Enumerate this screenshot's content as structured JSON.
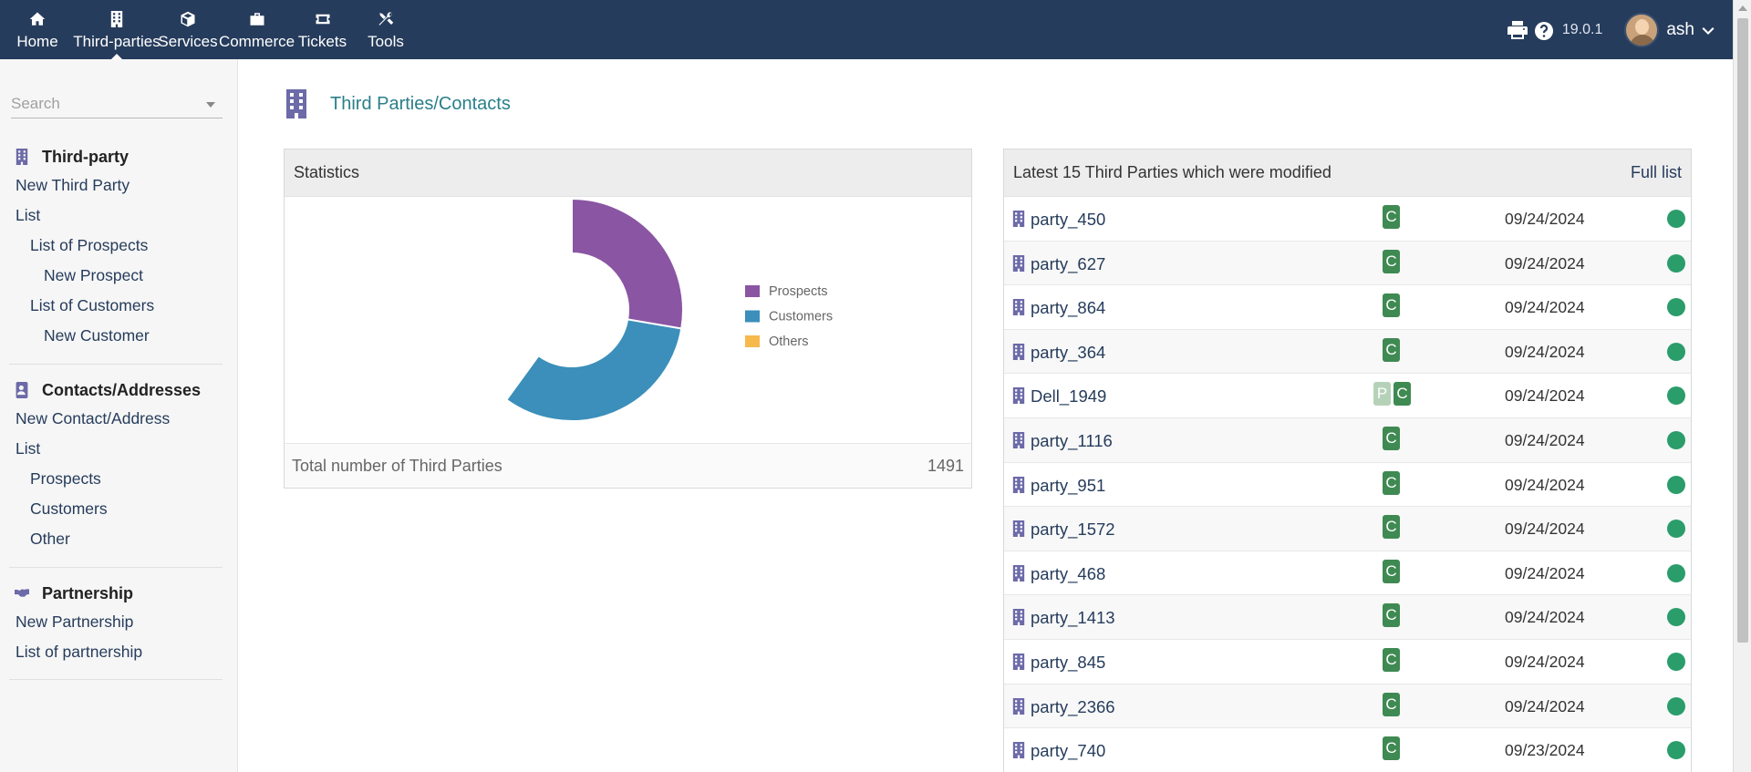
{
  "topnav": {
    "items": [
      {
        "label": "Home",
        "icon": "home-icon"
      },
      {
        "label": "Third-parties",
        "icon": "building-icon",
        "active": true
      },
      {
        "label": "Services",
        "icon": "cube-icon"
      },
      {
        "label": "Commerce",
        "icon": "briefcase-icon"
      },
      {
        "label": "Tickets",
        "icon": "ticket-icon"
      },
      {
        "label": "Tools",
        "icon": "tools-icon"
      }
    ],
    "version": "19.0.1",
    "username": "ash"
  },
  "sidebar": {
    "search_placeholder": "Search",
    "sections": [
      {
        "title": "Third-party",
        "icon": "building-icon",
        "links": [
          {
            "label": "New Third Party",
            "level": 0
          },
          {
            "label": "List",
            "level": 0
          },
          {
            "label": "List of Prospects",
            "level": 1
          },
          {
            "label": "New Prospect",
            "level": 2
          },
          {
            "label": "List of Customers",
            "level": 1
          },
          {
            "label": "New Customer",
            "level": 2
          }
        ]
      },
      {
        "title": "Contacts/Addresses",
        "icon": "address-book-icon",
        "links": [
          {
            "label": "New Contact/Address",
            "level": 0
          },
          {
            "label": "List",
            "level": 0
          },
          {
            "label": "Prospects",
            "level": 1
          },
          {
            "label": "Customers",
            "level": 1
          },
          {
            "label": "Other",
            "level": 1
          }
        ]
      },
      {
        "title": "Partnership",
        "icon": "handshake-icon",
        "links": [
          {
            "label": "New Partnership",
            "level": 0
          },
          {
            "label": "List of partnership",
            "level": 0
          }
        ]
      }
    ]
  },
  "main": {
    "title": "Third Parties/Contacts",
    "statistics": {
      "title": "Statistics",
      "total_label": "Total number of Third Parties",
      "total_value": "1491"
    },
    "latest": {
      "title": "Latest 15 Third Parties which were modified",
      "full_list_label": "Full list",
      "rows": [
        {
          "name": "party_450",
          "badges": [
            "C"
          ],
          "date": "09/24/2024"
        },
        {
          "name": "party_627",
          "badges": [
            "C"
          ],
          "date": "09/24/2024"
        },
        {
          "name": "party_864",
          "badges": [
            "C"
          ],
          "date": "09/24/2024"
        },
        {
          "name": "party_364",
          "badges": [
            "C"
          ],
          "date": "09/24/2024"
        },
        {
          "name": "Dell_1949",
          "badges": [
            "P",
            "C"
          ],
          "date": "09/24/2024"
        },
        {
          "name": "party_1116",
          "badges": [
            "C"
          ],
          "date": "09/24/2024"
        },
        {
          "name": "party_951",
          "badges": [
            "C"
          ],
          "date": "09/24/2024"
        },
        {
          "name": "party_1572",
          "badges": [
            "C"
          ],
          "date": "09/24/2024"
        },
        {
          "name": "party_468",
          "badges": [
            "C"
          ],
          "date": "09/24/2024"
        },
        {
          "name": "party_1413",
          "badges": [
            "C"
          ],
          "date": "09/24/2024"
        },
        {
          "name": "party_845",
          "badges": [
            "C"
          ],
          "date": "09/24/2024"
        },
        {
          "name": "party_2366",
          "badges": [
            "C"
          ],
          "date": "09/24/2024"
        },
        {
          "name": "party_740",
          "badges": [
            "C"
          ],
          "date": "09/23/2024"
        }
      ]
    }
  },
  "chart_data": {
    "type": "pie",
    "style": "half-doughnut",
    "categories": [
      "Prospects",
      "Customers",
      "Others"
    ],
    "values": [
      30,
      35,
      0
    ],
    "colors": [
      "#8a55a3",
      "#3b8fba",
      "#f6b94c"
    ],
    "legend_position": "right"
  },
  "colors": {
    "topbar": "#263c5c",
    "accent_title": "#2a7f8a",
    "badge_customer": "#3f8a52",
    "badge_prospect": "#b5d2b8",
    "status_active": "#2a9d6a"
  }
}
